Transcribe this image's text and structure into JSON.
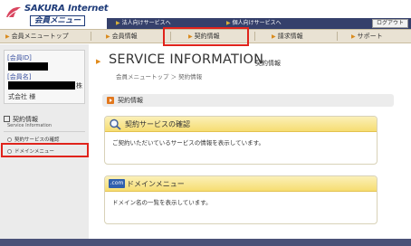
{
  "header": {
    "logo_en": "SAKURA Internet",
    "logo_jp": "会員メニュー",
    "util_links": [
      "法人向けサービスへ",
      "個人向けサービスへ"
    ],
    "logout_label": "ログアウト"
  },
  "nav": {
    "items": [
      {
        "label": "会員メニュートップ"
      },
      {
        "label": "会員情報"
      },
      {
        "label": "契約情報"
      },
      {
        "label": "請求情報"
      },
      {
        "label": "サポート"
      }
    ]
  },
  "sidebar": {
    "member_id_label": "[会員ID]",
    "member_name_label": "[会員名]",
    "member_name_suffix": "株",
    "company_line": "式会社 様",
    "section_title": "契約情報",
    "section_subtitle": "Service Information",
    "items": [
      {
        "label": "契約サービスの確認"
      },
      {
        "label": "ドメインメニュー"
      }
    ]
  },
  "main": {
    "title": "SERVICE INFORMATION",
    "subtitle": "契約情報",
    "breadcrumb": "会員メニュートップ ＞ 契約情報",
    "section_label": "契約情報",
    "cards": [
      {
        "title": "契約サービスの確認",
        "body": "ご契約いただいているサービスの情報を表示しています。"
      },
      {
        "badge": ".com",
        "title": "ドメインメニュー",
        "body": "ドメイン名の一覧を表示しています。"
      }
    ]
  },
  "colors": {
    "util_bar": "#35406b",
    "nav_bg": "#e9e2d3",
    "highlight": "#e0231b",
    "card_header": "#f6dd72",
    "accent_orange": "#e2781e"
  }
}
